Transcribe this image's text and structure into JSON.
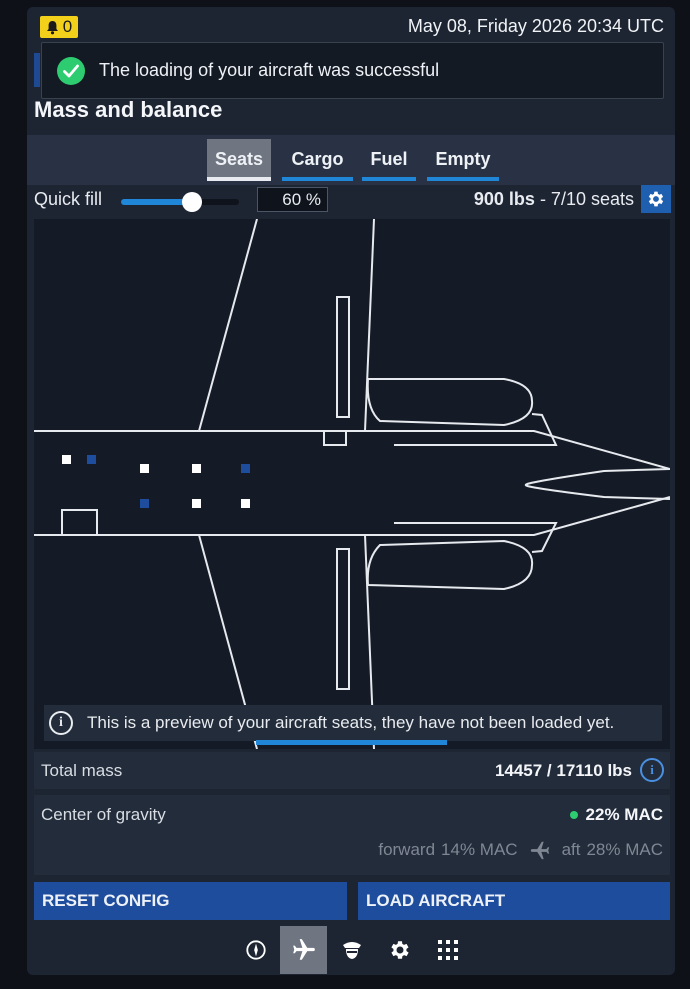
{
  "status_bar": {
    "notification_count": "0",
    "datetime": "May 08, Friday 2026 20:34 UTC"
  },
  "toast": {
    "message": "The loading of your aircraft was successful",
    "icon": "check-circle-icon",
    "color": "#2ecc71"
  },
  "page": {
    "title": "Mass and balance"
  },
  "tabs": [
    {
      "label": "Seats",
      "active": true
    },
    {
      "label": "Cargo",
      "active": false
    },
    {
      "label": "Fuel",
      "active": false
    },
    {
      "label": "Empty",
      "active": false
    }
  ],
  "quick_fill": {
    "label": "Quick fill",
    "percent_value": "60 %",
    "slider_fraction": 0.6,
    "weight": "900 lbs",
    "seats": "- 7/10 seats",
    "settings_icon": "gear-icon"
  },
  "preview": {
    "note": "This is a preview of your aircraft seats, they have not been loaded yet.",
    "seats_filled": 7,
    "seats_total": 10
  },
  "total_mass": {
    "label": "Total mass",
    "value": "14457 / 17110 lbs"
  },
  "center_of_gravity": {
    "label": "Center of gravity",
    "value": "22% MAC",
    "status_color": "#2ecc71",
    "forward_label": "forward",
    "forward_value": "14% MAC",
    "aft_label": "aft",
    "aft_value": "28% MAC"
  },
  "actions": {
    "reset_label": "RESET CONFIG",
    "load_label": "LOAD AIRCRAFT"
  },
  "bottom_nav": [
    {
      "icon": "compass-icon",
      "active": false
    },
    {
      "icon": "airplane-icon",
      "active": true
    },
    {
      "icon": "pilot-icon",
      "active": false
    },
    {
      "icon": "gear-icon",
      "active": false
    },
    {
      "icon": "apps-grid-icon",
      "active": false
    }
  ],
  "colors": {
    "accent": "#1f86d8",
    "button": "#1f4d9e",
    "badge": "#f3d11a",
    "seat_empty": "#1f4d9e",
    "seat_filled": "#ffffff"
  }
}
